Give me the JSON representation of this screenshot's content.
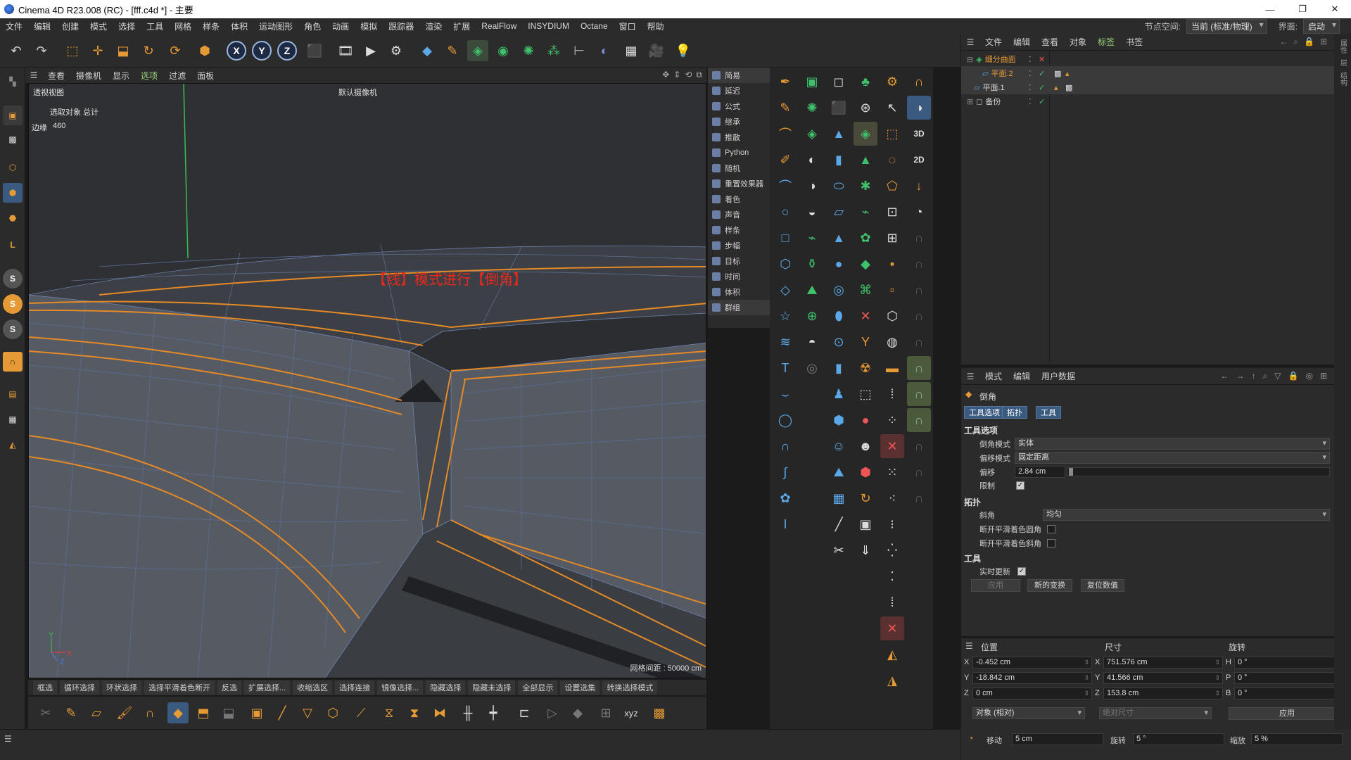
{
  "window": {
    "title": "Cinema 4D R23.008 (RC) - [fff.c4d *] - 主要",
    "controls": [
      "—",
      "❐",
      "✕"
    ]
  },
  "menubar": {
    "items": [
      "文件",
      "编辑",
      "创建",
      "模式",
      "选择",
      "工具",
      "网格",
      "样条",
      "体积",
      "运动图形",
      "角色",
      "动画",
      "模拟",
      "跟踪器",
      "渲染",
      "扩展",
      "RealFlow",
      "INSYDIUM",
      "Octane",
      "窗口",
      "帮助"
    ],
    "node_space_label": "节点空间:",
    "node_space_value": "当前 (标准/物理)",
    "layout_label": "界面:",
    "layout_value": "启动"
  },
  "toolbar": {
    "axis_x": "X",
    "axis_y": "Y",
    "axis_z": "Z"
  },
  "viewport": {
    "menu": [
      "查看",
      "摄像机",
      "显示",
      "选项",
      "过滤",
      "面板"
    ],
    "active_menu": "选项",
    "view_name": "透视视图",
    "camera": "默认摄像机",
    "stats_label": "选取对象 总计",
    "edges_label": "边缘",
    "edges_value": "460",
    "annotation": "【线】模式进行【倒角】",
    "grid_label": "网格间距 : 50000 cm",
    "axis_y_label": "Y",
    "axis_x_label": "X",
    "axis_z_label": "Z"
  },
  "bottom_toolbar": {
    "buttons": [
      "框选",
      "循环选择",
      "环状选择",
      "选择平滑着色断开",
      "反选",
      "扩展选择...",
      "收缩选区",
      "选择连接",
      "镜像选择...",
      "隐藏选择",
      "隐藏未选择",
      "全部显示",
      "设置选集",
      "转换选择模式"
    ]
  },
  "side_panel": {
    "items": [
      "简易",
      "延迟",
      "公式",
      "继承",
      "推散",
      "Python",
      "随机",
      "重置效果器",
      "着色",
      "声音",
      "样条",
      "步幅",
      "目标",
      "时间",
      "体积",
      "群组"
    ]
  },
  "object_manager": {
    "menu": [
      "文件",
      "编辑",
      "查看",
      "对象",
      "标签",
      "书签"
    ],
    "active_menu": "标签",
    "objects": [
      {
        "name": "细分曲面",
        "selected": true
      },
      {
        "name": "平面.2",
        "selected": true
      },
      {
        "name": "平面.1",
        "selected": false
      },
      {
        "name": "备份",
        "selected": false
      }
    ]
  },
  "attribute_manager": {
    "menu": [
      "模式",
      "编辑",
      "用户数据"
    ],
    "tool_name": "倒角",
    "tabs": [
      "工具选项",
      "拓扑",
      "工具"
    ],
    "section_tool_options": "工具选项",
    "bevel_mode_label": "倒角模式",
    "bevel_mode_value": "实体",
    "offset_mode_label": "偏移模式",
    "offset_mode_value": "固定距离",
    "offset_label": "偏移",
    "offset_value": "2.84 cm",
    "limit_label": "限制",
    "limit_checked": "✓",
    "section_topology": "拓扑",
    "miter_label": "斜角",
    "miter_value": "均匀",
    "break_phong_round_label": "断开平滑着色圆角",
    "break_phong_miter_label": "断开平滑着色斜角",
    "section_tool": "工具",
    "realtime_label": "实时更新",
    "realtime_checked": "✓",
    "apply_label": "应用",
    "new_transform_label": "新的变换",
    "reset_label": "复位数值"
  },
  "coordinates": {
    "position_header": "位置",
    "size_header": "尺寸",
    "rotation_header": "旋转",
    "pos_x": "-0.452 cm",
    "pos_y": "-18.842 cm",
    "pos_z": "0 cm",
    "size_x": "751.576 cm",
    "size_y": "41.566 cm",
    "size_z": "153.8 cm",
    "rot_h": "0 °",
    "rot_p": "0 °",
    "rot_b": "0 °",
    "label_x": "X",
    "label_y": "Y",
    "label_z": "Z",
    "label_h": "H",
    "label_p": "P",
    "label_b": "B",
    "mode_value": "对象 (相对)",
    "size_mode_value": "绝对尺寸",
    "apply_label": "应用"
  },
  "snap_bar": {
    "move_label": "移动",
    "move_value": "5 cm",
    "rotate_label": "旋转",
    "rotate_value": "5 °",
    "scale_label": "缩放",
    "scale_value": "5 %"
  },
  "right_strip": [
    "属性",
    "层",
    "结构"
  ],
  "colors": {
    "accent_orange": "#e59a36",
    "accent_green": "#9fd27a",
    "tab_blue": "#3a5a80",
    "annotation_red": "#e8291b"
  }
}
